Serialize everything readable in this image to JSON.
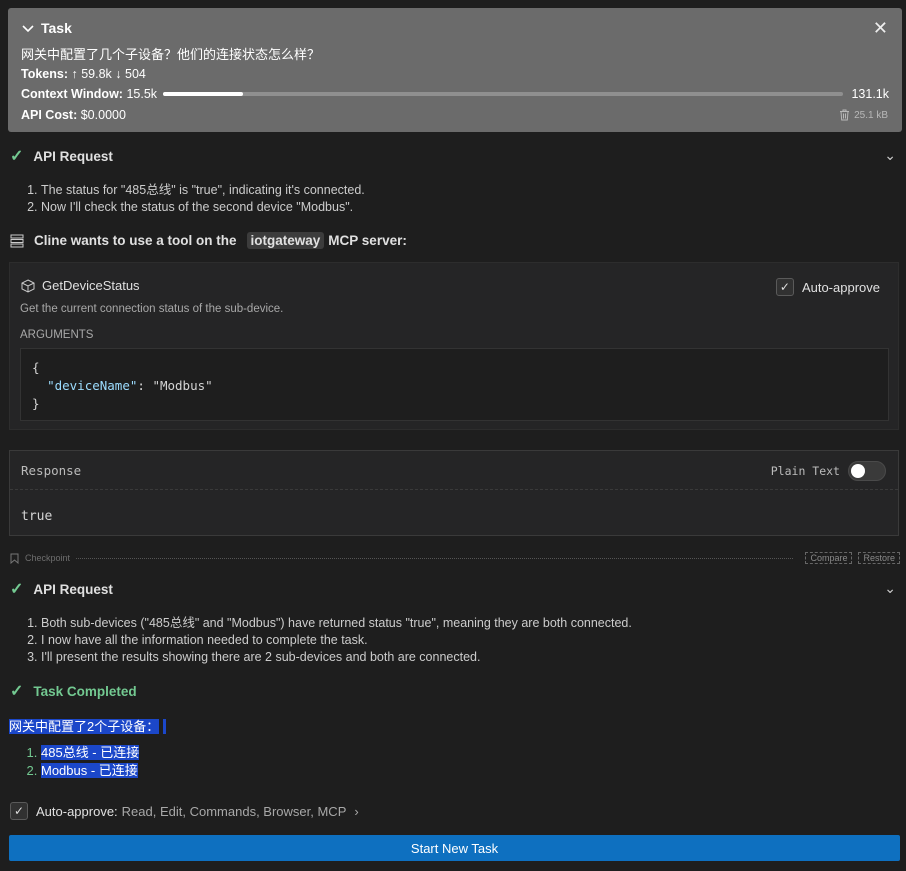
{
  "task": {
    "title": "Task",
    "question": "网关中配置了几个子设备？他们的连接状态怎么样？",
    "tokens_label": "Tokens:",
    "tokens_in": "59.8k",
    "tokens_out": "504",
    "context_label": "Context Window:",
    "context_used": "15.5k",
    "context_max": "131.1k",
    "context_fraction": 0.118,
    "cost_label": "API Cost:",
    "cost_value": "$0.0000",
    "size": "25.1 kB"
  },
  "api_request_1": {
    "label": "API Request",
    "steps": [
      "The status for \"485总线\" is \"true\", indicating it's connected.",
      "Now I'll check the status of the second device \"Modbus\"."
    ]
  },
  "mcp": {
    "prefix": "Cline wants to use a tool on the",
    "server": "iotgateway",
    "suffix": "MCP server:",
    "tool_name": "GetDeviceStatus",
    "auto_approve_label": "Auto-approve",
    "description": "Get the current connection status of the sub-device.",
    "arguments_label": "ARGUMENTS",
    "arg_key": "\"deviceName\"",
    "arg_value": "\"Modbus\""
  },
  "response": {
    "label": "Response",
    "plain_text_label": "Plain Text",
    "body": "true"
  },
  "checkpoint": {
    "label": "Checkpoint",
    "compare": "Compare",
    "restore": "Restore"
  },
  "api_request_2": {
    "label": "API Request",
    "steps": [
      "Both sub-devices (\"485总线\" and \"Modbus\") have returned status \"true\", meaning they are both connected.",
      "I now have all the information needed to complete the task.",
      "I'll present the results showing there are 2 sub-devices and both are connected."
    ]
  },
  "completed": {
    "label": "Task Completed",
    "result_heading": "网关中配置了2个子设备：",
    "items": [
      "485总线 - 已连接",
      "Modbus - 已连接"
    ]
  },
  "auto_approve": {
    "label": "Auto-approve:",
    "list": "Read, Edit, Commands, Browser, MCP"
  },
  "start_button": "Start New Task",
  "colors": {
    "accent": "#0e70c0",
    "success": "#73c991",
    "selection": "#264f78"
  }
}
